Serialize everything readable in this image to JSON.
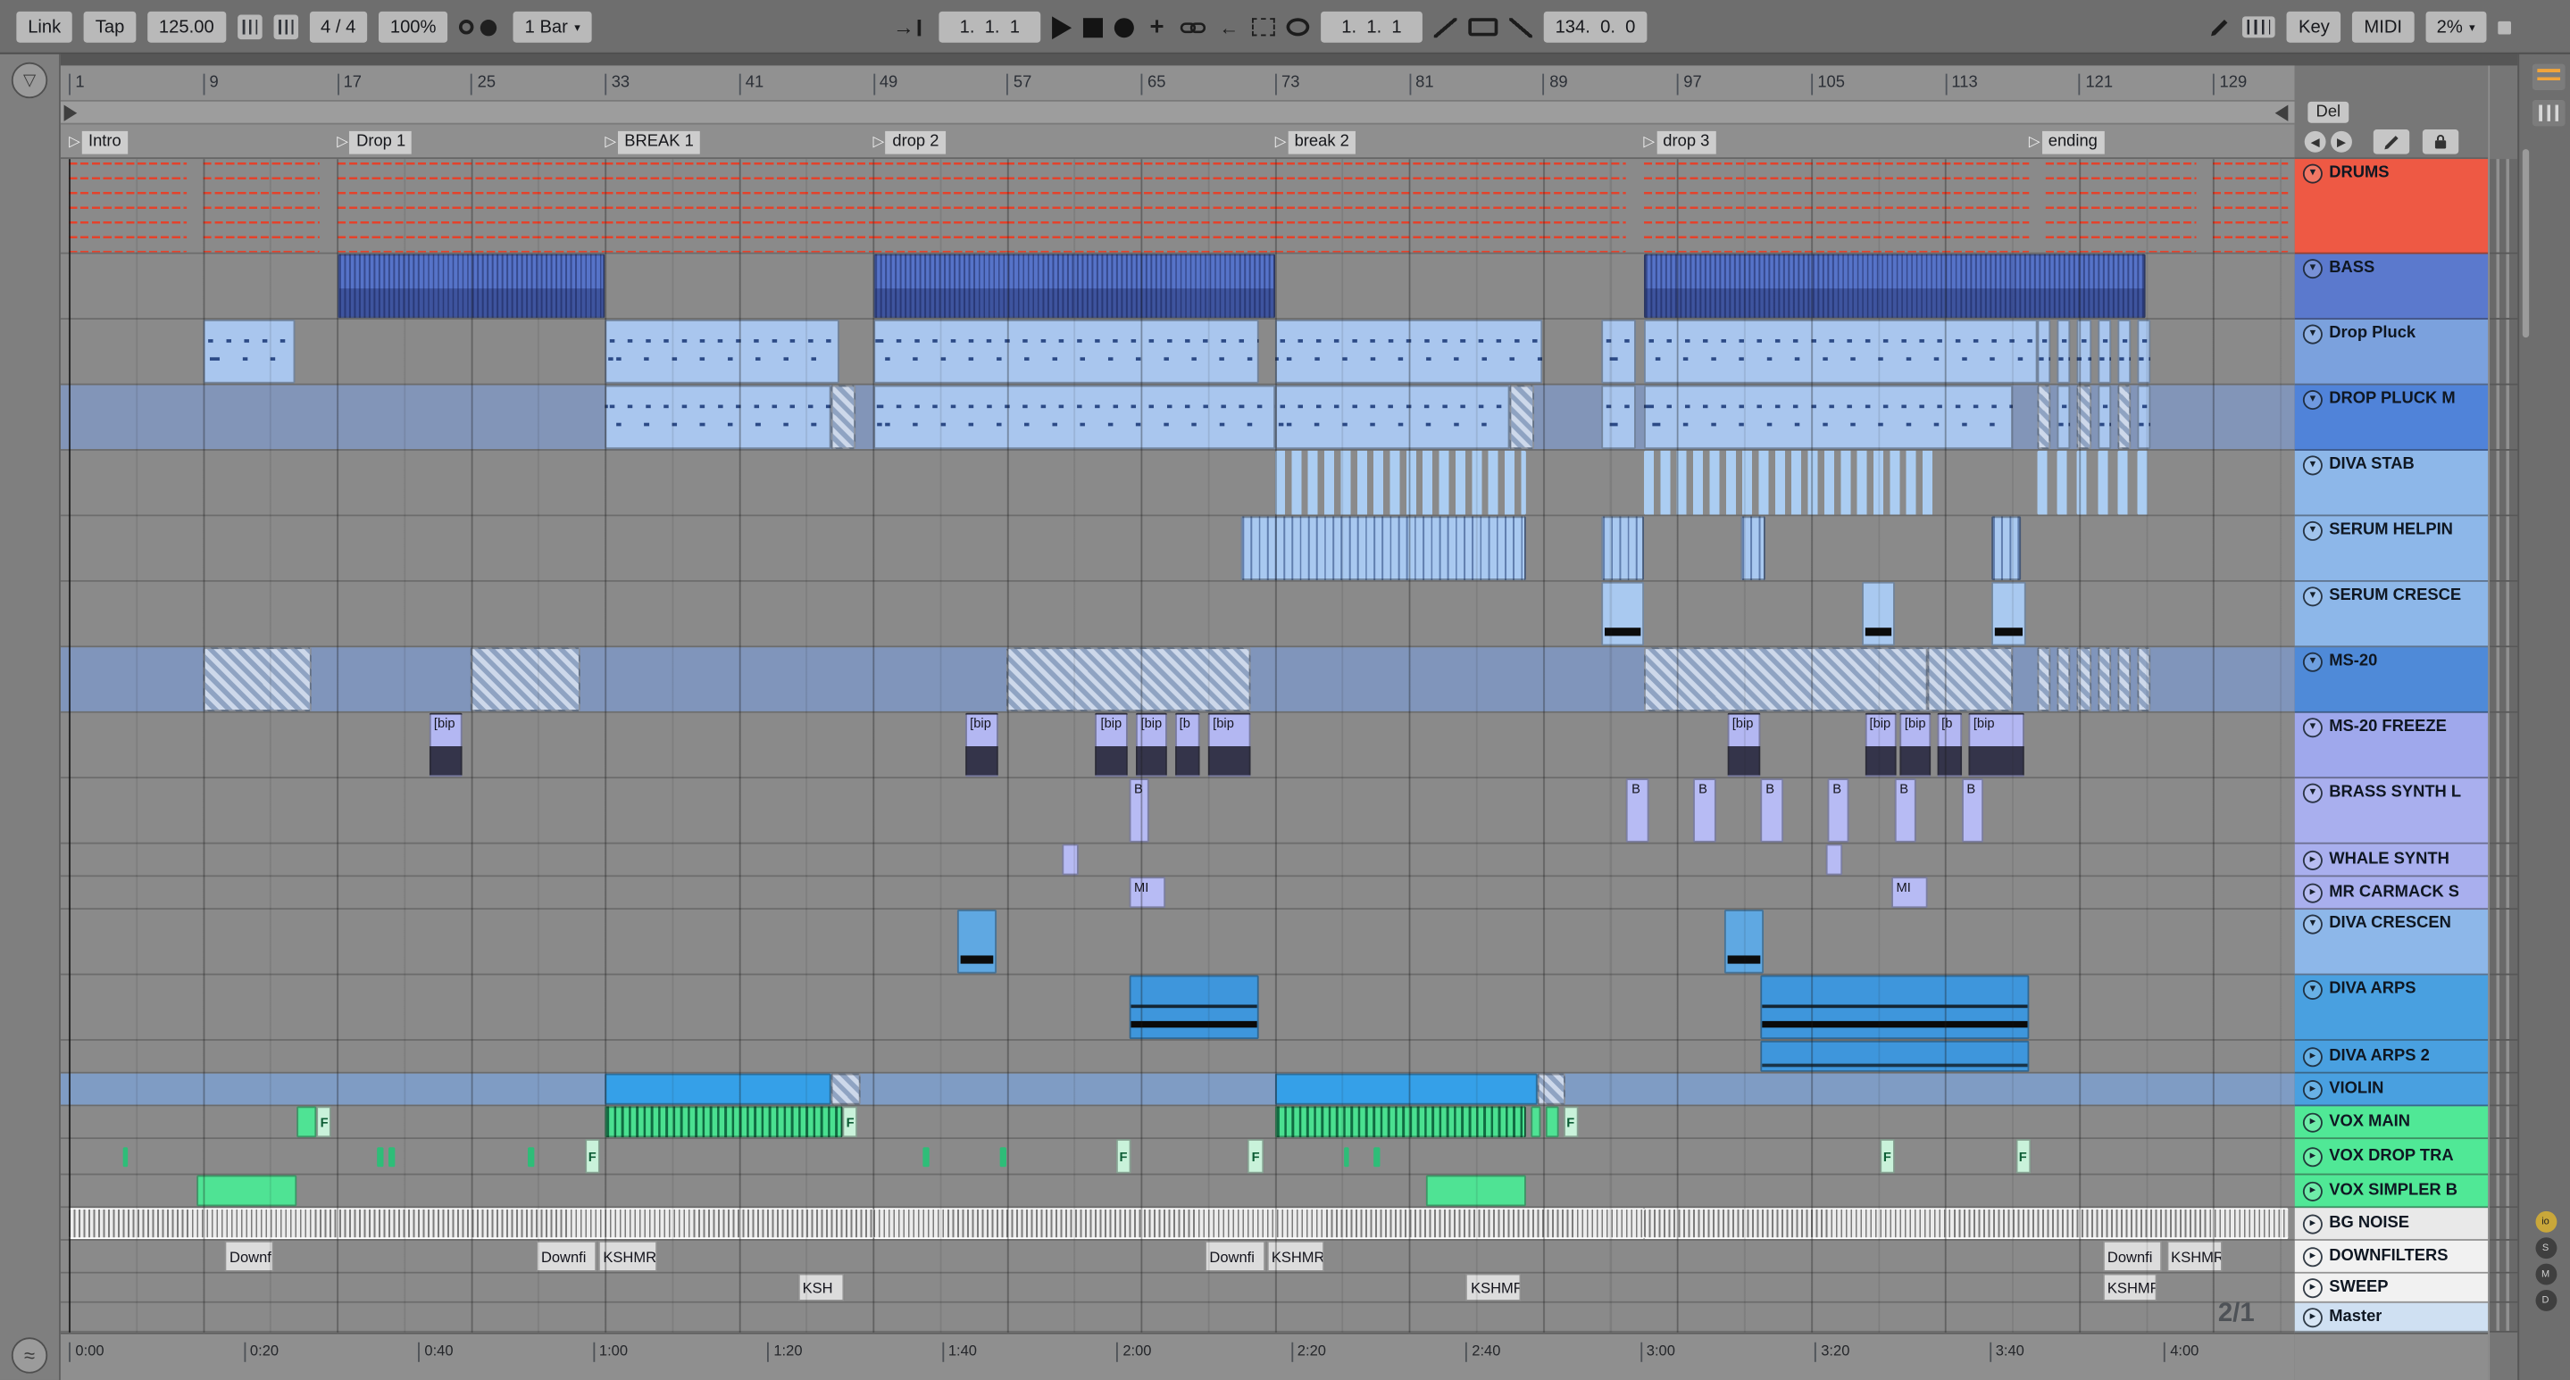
{
  "toolbar": {
    "link": "Link",
    "tap": "Tap",
    "tempo": "125.00",
    "time_sig": "4 / 4",
    "groove": "100%",
    "quantize": "1 Bar",
    "position": "1.  1.  1",
    "loop_start": "1.  1.  1",
    "loop_length": "134.  0.  0",
    "key": "Key",
    "midi": "MIDI",
    "cpu": "2%"
  },
  "edit_bar": {
    "del": "Del"
  },
  "ruler_bars": [
    1,
    9,
    17,
    25,
    33,
    41,
    49,
    57,
    65,
    73,
    81,
    89,
    97,
    105,
    113,
    121,
    129
  ],
  "locators": [
    {
      "label": "Intro",
      "bar": 1
    },
    {
      "label": "Drop 1",
      "bar": 17
    },
    {
      "label": "BREAK 1",
      "bar": 33
    },
    {
      "label": "drop 2",
      "bar": 49
    },
    {
      "label": "break 2",
      "bar": 73
    },
    {
      "label": "drop 3",
      "bar": 95
    },
    {
      "label": "ending",
      "bar": 118
    }
  ],
  "time_labels": [
    "0:00",
    "0:20",
    "0:40",
    "1:00",
    "1:20",
    "1:40",
    "2:00",
    "2:20",
    "2:40",
    "3:00",
    "3:20",
    "3:40",
    "4:00"
  ],
  "time_sig_marker": "2/1",
  "right_bar_toggles": [
    "io",
    "S",
    "M",
    "D"
  ],
  "colors": {
    "drums_red": "#ee5944",
    "bass_blue": "#5b79cd",
    "arps_blue": "#49a0e0",
    "vox_green": "#50e896",
    "purple": "#a9afee",
    "master_blue": "#cfe0f2"
  },
  "tracks": [
    {
      "name": "DRUMS",
      "color": "#ee5944",
      "h": 58,
      "folded": false
    },
    {
      "name": "BASS",
      "color": "#5b79cd",
      "h": 40,
      "folded": false
    },
    {
      "name": "Drop Pluck",
      "color": "#7ba1dd",
      "h": 40,
      "folded": false
    },
    {
      "name": "DROP PLUCK M",
      "color": "#5083d9",
      "h": 40,
      "folded": false,
      "row": "#8295b8"
    },
    {
      "name": "DIVA STAB",
      "color": "#8db7e9",
      "h": 40,
      "folded": false
    },
    {
      "name": "SERUM HELPIN",
      "color": "#8db7e9",
      "h": 40,
      "folded": false
    },
    {
      "name": "SERUM CRESCE",
      "color": "#8db7e9",
      "h": 40,
      "folded": false
    },
    {
      "name": "MS-20",
      "color": "#4f8ad8",
      "h": 40,
      "folded": false,
      "row": "#8095bb"
    },
    {
      "name": "MS-20 FREEZE",
      "color": "#9fa8ec",
      "h": 40,
      "folded": false
    },
    {
      "name": "BRASS SYNTH L",
      "color": "#a9afee",
      "h": 40,
      "folded": false
    },
    {
      "name": "WHALE SYNTH",
      "color": "#a9afee",
      "h": 20,
      "folded": true
    },
    {
      "name": "MR CARMACK S",
      "color": "#a9afee",
      "h": 20,
      "folded": true
    },
    {
      "name": "DIVA CRESCEN",
      "color": "#8db7e9",
      "h": 40,
      "folded": false
    },
    {
      "name": "DIVA ARPS",
      "color": "#49a0e0",
      "h": 40,
      "folded": false
    },
    {
      "name": "DIVA ARPS 2",
      "color": "#49a0e0",
      "h": 20,
      "folded": true
    },
    {
      "name": "VIOLIN",
      "color": "#49a0e0",
      "h": 20,
      "folded": true,
      "row": "#7f9cc4"
    },
    {
      "name": "VOX MAIN",
      "color": "#50e896",
      "h": 20,
      "folded": true
    },
    {
      "name": "VOX DROP TRA",
      "color": "#50e896",
      "h": 22,
      "folded": true
    },
    {
      "name": "VOX SIMPLER B",
      "color": "#50e896",
      "h": 20,
      "folded": true
    },
    {
      "name": "BG NOISE",
      "color": "#e9e9e9",
      "h": 20,
      "folded": true
    },
    {
      "name": "DOWNFILTERS",
      "color": "#f1f1f1",
      "h": 20,
      "folded": true
    },
    {
      "name": "SWEEP",
      "color": "#f1f1f1",
      "h": 18,
      "folded": true
    },
    {
      "name": "Master",
      "color": "#cfe0f2",
      "h": 18,
      "folded": true
    }
  ],
  "clips": [
    {
      "t": 0,
      "b": 1,
      "l": 7,
      "s": "drums"
    },
    {
      "t": 0,
      "b": 9,
      "l": 7,
      "s": "drums"
    },
    {
      "t": 0,
      "b": 17,
      "l": 16,
      "s": "drums"
    },
    {
      "t": 0,
      "b": 33,
      "l": 16,
      "s": "drums"
    },
    {
      "t": 0,
      "b": 49,
      "l": 8,
      "s": "drums"
    },
    {
      "t": 0,
      "b": 57,
      "l": 16,
      "s": "drums"
    },
    {
      "t": 0,
      "b": 73,
      "l": 16,
      "s": "drums"
    },
    {
      "t": 0,
      "b": 89,
      "l": 5,
      "s": "drums"
    },
    {
      "t": 0,
      "b": 95,
      "l": 23,
      "s": "drums"
    },
    {
      "t": 0,
      "b": 119,
      "l": 9,
      "s": "drums"
    },
    {
      "t": 0,
      "b": 129,
      "l": 4.5,
      "s": "drums"
    },
    {
      "t": 1,
      "b": 17,
      "l": 16,
      "s": "bass"
    },
    {
      "t": 1,
      "b": 49,
      "l": 24,
      "s": "bass"
    },
    {
      "t": 1,
      "b": 95,
      "l": 30,
      "s": "bass"
    },
    {
      "t": 2,
      "b": 9,
      "l": 5.5,
      "s": "notes"
    },
    {
      "t": 2,
      "b": 33,
      "l": 14,
      "s": "notes"
    },
    {
      "t": 2,
      "b": 49,
      "l": 23,
      "s": "notes"
    },
    {
      "t": 2,
      "b": 73,
      "l": 16,
      "s": "notes"
    },
    {
      "t": 2,
      "b": 92.5,
      "l": 2,
      "s": "notes"
    },
    {
      "t": 2,
      "b": 95,
      "l": 23.5,
      "s": "notes"
    },
    {
      "t": 2,
      "b": 118.5,
      "l": 0.8,
      "s": "notes"
    },
    {
      "t": 2,
      "b": 119.7,
      "l": 0.8,
      "s": "notes"
    },
    {
      "t": 2,
      "b": 120.9,
      "l": 0.8,
      "s": "notes"
    },
    {
      "t": 2,
      "b": 122.1,
      "l": 0.8,
      "s": "notes"
    },
    {
      "t": 2,
      "b": 123.3,
      "l": 0.8,
      "s": "notes"
    },
    {
      "t": 2,
      "b": 124.5,
      "l": 0.8,
      "s": "notes"
    },
    {
      "t": 3,
      "b": 33,
      "l": 13.5,
      "s": "notes"
    },
    {
      "t": 3,
      "b": 46.5,
      "l": 1.5,
      "s": "hatch"
    },
    {
      "t": 3,
      "b": 49,
      "l": 24,
      "s": "notes"
    },
    {
      "t": 3,
      "b": 73,
      "l": 14,
      "s": "notes"
    },
    {
      "t": 3,
      "b": 87,
      "l": 1.5,
      "s": "hatch"
    },
    {
      "t": 3,
      "b": 92.5,
      "l": 2,
      "s": "notes"
    },
    {
      "t": 3,
      "b": 95,
      "l": 22,
      "s": "notes"
    },
    {
      "t": 3,
      "b": 118.5,
      "l": 0.8,
      "s": "hatch"
    },
    {
      "t": 3,
      "b": 119.7,
      "l": 0.8,
      "s": "notes"
    },
    {
      "t": 3,
      "b": 120.9,
      "l": 0.8,
      "s": "hatch"
    },
    {
      "t": 3,
      "b": 122.1,
      "l": 0.8,
      "s": "notes"
    },
    {
      "t": 3,
      "b": 123.3,
      "l": 0.8,
      "s": "hatch"
    },
    {
      "t": 3,
      "b": 124.5,
      "l": 0.8,
      "s": "notes"
    },
    {
      "t": 4,
      "b": 73,
      "l": 15,
      "s": "vbars"
    },
    {
      "t": 4,
      "b": 95,
      "l": 17.5,
      "s": "vbars"
    },
    {
      "t": 4,
      "b": 118.5,
      "l": 0.8,
      "s": "vbars"
    },
    {
      "t": 4,
      "b": 119.7,
      "l": 0.8,
      "s": "vbars"
    },
    {
      "t": 4,
      "b": 120.9,
      "l": 0.8,
      "s": "vbars"
    },
    {
      "t": 4,
      "b": 122.1,
      "l": 0.8,
      "s": "vbars"
    },
    {
      "t": 4,
      "b": 123.3,
      "l": 0.8,
      "s": "vbars"
    },
    {
      "t": 4,
      "b": 124.5,
      "l": 0.8,
      "s": "vbars"
    },
    {
      "t": 5,
      "b": 71,
      "l": 17,
      "s": "vlines"
    },
    {
      "t": 5,
      "b": 92.5,
      "l": 2.5,
      "s": "vlines"
    },
    {
      "t": 5,
      "b": 100.8,
      "l": 1.5,
      "s": "vlines"
    },
    {
      "t": 5,
      "b": 115.8,
      "l": 1.7,
      "s": "vlines"
    },
    {
      "t": 6,
      "b": 92.5,
      "l": 2.5,
      "s": "cresc"
    },
    {
      "t": 6,
      "b": 108,
      "l": 2,
      "s": "cresc"
    },
    {
      "t": 6,
      "b": 115.8,
      "l": 2,
      "s": "cresc"
    },
    {
      "t": 7,
      "b": 9,
      "l": 6.5,
      "s": "hatch"
    },
    {
      "t": 7,
      "b": 25,
      "l": 6.5,
      "s": "hatch"
    },
    {
      "t": 7,
      "b": 57,
      "l": 14.5,
      "s": "hatch"
    },
    {
      "t": 7,
      "b": 95,
      "l": 17,
      "s": "hatch"
    },
    {
      "t": 7,
      "b": 112,
      "l": 5,
      "s": "hatch"
    },
    {
      "t": 7,
      "b": 118.5,
      "l": 0.8,
      "s": "hatch"
    },
    {
      "t": 7,
      "b": 119.7,
      "l": 0.8,
      "s": "hatch"
    },
    {
      "t": 7,
      "b": 120.9,
      "l": 0.8,
      "s": "hatch"
    },
    {
      "t": 7,
      "b": 122.1,
      "l": 0.8,
      "s": "hatch"
    },
    {
      "t": 7,
      "b": 123.3,
      "l": 0.8,
      "s": "hatch"
    },
    {
      "t": 7,
      "b": 124.5,
      "l": 0.8,
      "s": "hatch"
    },
    {
      "t": 8,
      "b": 22.5,
      "l": 2,
      "s": "freeze",
      "lb": "[bip"
    },
    {
      "t": 8,
      "b": 54.5,
      "l": 2,
      "s": "freeze",
      "lb": "[bip"
    },
    {
      "t": 8,
      "b": 62.3,
      "l": 1.9,
      "s": "freeze",
      "lb": "[bip"
    },
    {
      "t": 8,
      "b": 64.7,
      "l": 1.9,
      "s": "freeze",
      "lb": "[bip"
    },
    {
      "t": 8,
      "b": 67,
      "l": 1.5,
      "s": "freeze",
      "lb": "[b"
    },
    {
      "t": 8,
      "b": 69,
      "l": 2.5,
      "s": "freeze",
      "lb": "[bip"
    },
    {
      "t": 8,
      "b": 100,
      "l": 2,
      "s": "freeze",
      "lb": "[bip"
    },
    {
      "t": 8,
      "b": 108.2,
      "l": 1.9,
      "s": "freeze",
      "lb": "[bip"
    },
    {
      "t": 8,
      "b": 110.3,
      "l": 1.9,
      "s": "freeze",
      "lb": "[bip"
    },
    {
      "t": 8,
      "b": 112.5,
      "l": 1.5,
      "s": "freeze",
      "lb": "[b"
    },
    {
      "t": 8,
      "b": 114.4,
      "l": 3.3,
      "s": "freeze",
      "lb": "[bip"
    },
    {
      "t": 9,
      "b": 64.3,
      "l": 1.2,
      "s": "chip",
      "lb": "B"
    },
    {
      "t": 9,
      "b": 94,
      "l": 1.3,
      "s": "chip",
      "lb": "B"
    },
    {
      "t": 9,
      "b": 98,
      "l": 1.3,
      "s": "chip",
      "lb": "B"
    },
    {
      "t": 9,
      "b": 102,
      "l": 1.3,
      "s": "chip",
      "lb": "B"
    },
    {
      "t": 9,
      "b": 106,
      "l": 1.3,
      "s": "chip",
      "lb": "B"
    },
    {
      "t": 9,
      "b": 110,
      "l": 1.3,
      "s": "chip",
      "lb": "B"
    },
    {
      "t": 9,
      "b": 114,
      "l": 1.3,
      "s": "chip",
      "lb": "B"
    },
    {
      "t": 10,
      "b": 60.3,
      "l": 1,
      "s": "chip"
    },
    {
      "t": 10,
      "b": 105.9,
      "l": 1,
      "s": "chip"
    },
    {
      "t": 11,
      "b": 64.3,
      "l": 2.2,
      "s": "chip",
      "lb": "MI"
    },
    {
      "t": 11,
      "b": 109.8,
      "l": 2.2,
      "s": "chip",
      "lb": "MI"
    },
    {
      "t": 12,
      "b": 54,
      "l": 2.4,
      "s": "crescd"
    },
    {
      "t": 12,
      "b": 99.8,
      "l": 2.4,
      "s": "crescd"
    },
    {
      "t": 13,
      "b": 64.3,
      "l": 7.7,
      "s": "arps"
    },
    {
      "t": 13,
      "b": 102,
      "l": 16,
      "s": "arps"
    },
    {
      "t": 14,
      "b": 102,
      "l": 16,
      "s": "solidb"
    },
    {
      "t": 15,
      "b": 33,
      "l": 13.5,
      "s": "violin"
    },
    {
      "t": 15,
      "b": 46.5,
      "l": 1.8,
      "s": "hatch"
    },
    {
      "t": 15,
      "b": 73,
      "l": 15.7,
      "s": "violin"
    },
    {
      "t": 15,
      "b": 88.7,
      "l": 1.6,
      "s": "hatch"
    },
    {
      "t": 16,
      "b": 14.6,
      "l": 1.2,
      "s": "green"
    },
    {
      "t": 16,
      "b": 15.8,
      "l": 0.9,
      "s": "greenf",
      "lb": "F"
    },
    {
      "t": 16,
      "b": 33,
      "l": 14.2,
      "s": "greens"
    },
    {
      "t": 16,
      "b": 47.2,
      "l": 0.9,
      "s": "greenf",
      "lb": "F"
    },
    {
      "t": 16,
      "b": 73,
      "l": 15,
      "s": "greens"
    },
    {
      "t": 16,
      "b": 88.3,
      "l": 0.6,
      "s": "green"
    },
    {
      "t": 16,
      "b": 89.2,
      "l": 0.7,
      "s": "green"
    },
    {
      "t": 16,
      "b": 90.2,
      "l": 0.9,
      "s": "greenf",
      "lb": "F"
    },
    {
      "t": 17,
      "b": 4.2,
      "l": 0.35,
      "s": "gtick"
    },
    {
      "t": 17,
      "b": 19.4,
      "l": 0.35,
      "s": "gtick"
    },
    {
      "t": 17,
      "b": 20.1,
      "l": 0.35,
      "s": "gtick"
    },
    {
      "t": 17,
      "b": 28.4,
      "l": 0.35,
      "s": "gtick"
    },
    {
      "t": 17,
      "b": 31.8,
      "l": 0.9,
      "s": "greenf",
      "lb": "F"
    },
    {
      "t": 17,
      "b": 52,
      "l": 0.35,
      "s": "gtick"
    },
    {
      "t": 17,
      "b": 56.6,
      "l": 0.35,
      "s": "gtick"
    },
    {
      "t": 17,
      "b": 63.5,
      "l": 0.9,
      "s": "greenf",
      "lb": "F"
    },
    {
      "t": 17,
      "b": 71.4,
      "l": 0.9,
      "s": "greenf",
      "lb": "F"
    },
    {
      "t": 17,
      "b": 77.1,
      "l": 0.35,
      "s": "gtick"
    },
    {
      "t": 17,
      "b": 78.9,
      "l": 0.35,
      "s": "gtick"
    },
    {
      "t": 17,
      "b": 109.1,
      "l": 0.9,
      "s": "greenf",
      "lb": "F"
    },
    {
      "t": 17,
      "b": 117.2,
      "l": 0.9,
      "s": "greenf",
      "lb": "F"
    },
    {
      "t": 18,
      "b": 8.6,
      "l": 6,
      "s": "green"
    },
    {
      "t": 18,
      "b": 82,
      "l": 6,
      "s": "green"
    },
    {
      "t": 19,
      "b": 1,
      "l": 48,
      "s": "noise"
    },
    {
      "t": 19,
      "b": 49,
      "l": 46,
      "s": "noise"
    },
    {
      "t": 19,
      "b": 95,
      "l": 38.5,
      "s": "noise"
    },
    {
      "t": 20,
      "b": 10.3,
      "l": 2.9,
      "s": "chipw",
      "lb": "Downfi"
    },
    {
      "t": 20,
      "b": 28.9,
      "l": 3.6,
      "s": "chipw",
      "lb": "Downfi"
    },
    {
      "t": 20,
      "b": 32.6,
      "l": 3.5,
      "s": "chipw",
      "lb": "KSHMR"
    },
    {
      "t": 20,
      "b": 68.8,
      "l": 3.6,
      "s": "chipw",
      "lb": "Downfi"
    },
    {
      "t": 20,
      "b": 72.5,
      "l": 3.5,
      "s": "chipw",
      "lb": "KSHMR"
    },
    {
      "t": 20,
      "b": 122.4,
      "l": 3.6,
      "s": "chipw",
      "lb": "Downfi"
    },
    {
      "t": 20,
      "b": 126.2,
      "l": 3.4,
      "s": "chipw",
      "lb": "KSHMR"
    },
    {
      "t": 21,
      "b": 44.5,
      "l": 2.8,
      "s": "chipw",
      "lb": "KSH"
    },
    {
      "t": 21,
      "b": 84.4,
      "l": 3.3,
      "s": "chipw",
      "lb": "KSHMR"
    },
    {
      "t": 21,
      "b": 122.4,
      "l": 3.3,
      "s": "chipw",
      "lb": "KSHMR"
    }
  ]
}
